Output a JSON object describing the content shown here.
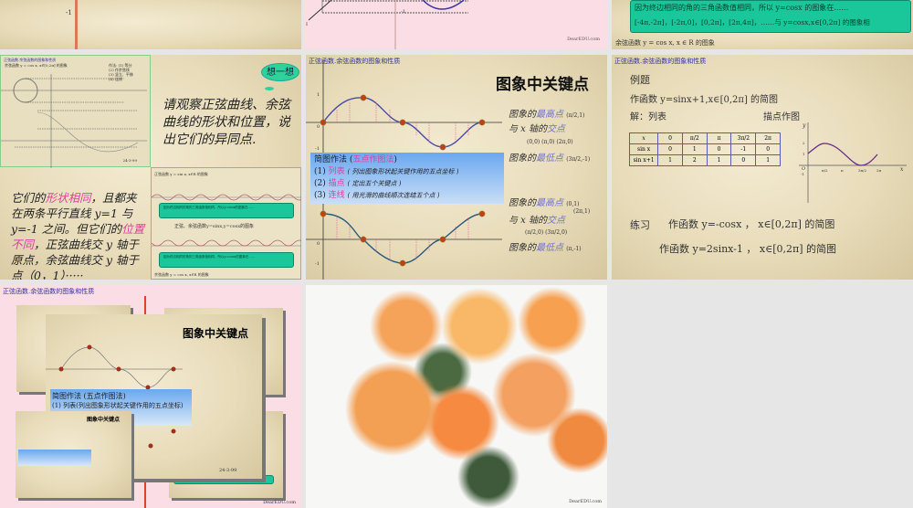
{
  "tiles": {
    "top_left": {
      "axis_label": "-1"
    },
    "top_middle": {
      "axis_label": "-1",
      "axis_label2": "I",
      "watermark": "DearEDU.com"
    },
    "top_right": {
      "green_line1": "因为终边相同的角的三角函数值相同，所以 y=cosx 的图象在……",
      "green_line2": "[-4π,-2π]，[-2π,0]，[0,2π]，[2π,4π]，……与 y=cosx,x∈[0,2π] 的图象相",
      "caption": "余弦函数 y = cos x, x ∈ R 的图象"
    },
    "compare": {
      "graph_title": "正弦函数.余弦函数的图象和性质",
      "graph_caption": "余弦函数 y = cos x, x∈[0,2π] 的图象",
      "steps": [
        "作法: (1) 等分",
        "(2) 作余弦线",
        "(3) 竖立、平移",
        "(4) 连线"
      ],
      "date": "24-3-99",
      "bubble": "想一想",
      "question": "请观察正弦曲线、余弦曲线的形状和位置，说出它们的异同点.",
      "answer_pre": "它们的",
      "answer_hl1": "形状相同",
      "answer_mid": "，且都夹在两条平行直线 y=1 与 y=-1 之间。但它们的",
      "answer_hl2": "位置不同",
      "answer_post": "，正弦曲线交 y 轴于原点，余弦曲线交 y 轴于点（0，1）·····",
      "wave_caption_top": "正弦函数 y = sin x, x∈R 的图象",
      "wave_center": "正弦、余弦函数y=sinx,y=cosx的图象",
      "wave_green1": "因为终边相同的角的三角函数值相同，所以y=sinx的图象在……",
      "wave_green2": "因为终边相同的角的三角函数值相同，所以y=cosx的图象在……",
      "wave_caption_bottom": "余弦函数 y = cos x, x∈R 的图象"
    },
    "keypoints": {
      "title": "正弦函数.余弦函数的图象和性质",
      "heading": "图象中关键点",
      "sin_max_label": "图象的",
      "max_word": "最高点",
      "sin_max_val": "(π/2,1)",
      "cross_label": "与 x 轴的",
      "cross_word": "交点",
      "sin_cross_vals": "(0,0)  (π,0)  (2π,0)",
      "min_label": "图象的",
      "min_word": "最低点",
      "sin_min_val": "(3π/2,-1)",
      "cos_max_val": "(0,1)",
      "cos_max_val2": "(2π,1)",
      "cos_cross_vals": "(π/2,0)  (3π/2,0)",
      "cos_min_val": "(π,-1)",
      "method_title": "简图作法 (",
      "method_name": "五点作图法",
      "method_close": ")",
      "steps": [
        {
          "num": "(1)",
          "name": "列表",
          "desc": "( 列出图象形状起关键作用的五点坐标 )"
        },
        {
          "num": "(2)",
          "name": "描点",
          "desc": "( 定出五个关键点 )"
        },
        {
          "num": "(3)",
          "name": "连线",
          "desc": "( 用光滑的曲线顺次连结五个点 )"
        }
      ],
      "y1": "1",
      "y0": "0",
      "ym1": "-1"
    },
    "example": {
      "title": "正弦函数.余弦函数的图象和性质",
      "heading": "例题",
      "task": "作函数 y=sinx+1,x∈[0,2π] 的简图",
      "solve": "解：列表",
      "plot": "描点作图",
      "table": [
        [
          "x",
          "0",
          "π/2",
          "π",
          "3π/2",
          "2π"
        ],
        [
          "sin x",
          "0",
          "1",
          "0",
          "-1",
          "0"
        ],
        [
          "sin x+1",
          "1",
          "2",
          "1",
          "0",
          "1"
        ]
      ],
      "axis": {
        "y": "y",
        "x": "x",
        "o": "O",
        "y2": "2",
        "y1": "1",
        "ym1": "-1",
        "ticks": [
          "π/2",
          "π",
          "3π/2",
          "2π"
        ]
      },
      "practice_label": "练习",
      "practice1": "作函数   y=-cosx ，  x∈[0,2π] 的简图",
      "practice2": "作函数   y=2sinx-1 ，  x∈[0,2π] 的简图"
    },
    "collage": {
      "title": "正弦函数.余弦函数的图象和性质",
      "heading": "图象中关键点",
      "method": "简图作法 (五点作图法)",
      "step1": "(1) 列表(列出图象形状起关键作用的五点坐标)",
      "date": "24-3-99",
      "watermark": "DearEDU.com"
    },
    "photo": {
      "watermark": "DearEDU.com"
    }
  }
}
